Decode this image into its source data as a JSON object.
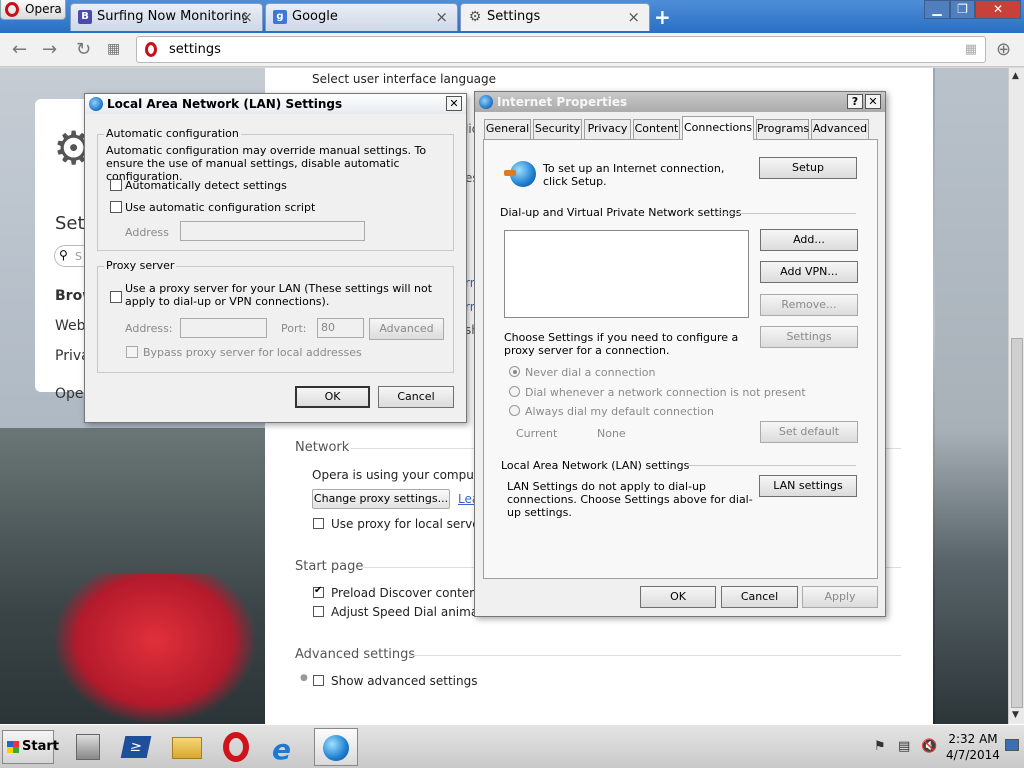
{
  "browser": {
    "menu_label": "Opera",
    "tabs": [
      {
        "label": "Surfing Now Monitoring",
        "icon": "bookmark-b-icon",
        "color": "#4a4ab0"
      },
      {
        "label": "Google",
        "icon": "google-icon",
        "color": "#3c78d8"
      },
      {
        "label": "Settings",
        "icon": "gear-icon",
        "color": "#555555"
      }
    ],
    "address": "settings"
  },
  "settings_page": {
    "left_card": {
      "title": "Set",
      "items": [
        "Brow",
        "Web",
        "Priva",
        "Ope"
      ],
      "search_placeholder": "S"
    },
    "lang_label": "Select user interface language",
    "network": {
      "heading": "Network",
      "description": "Opera is using your computer's sy",
      "change_proxy_button": "Change proxy settings...",
      "learn_link": "Lea",
      "use_proxy_local": "Use proxy for local servers"
    },
    "start_page": {
      "heading": "Start page",
      "preload_discover": "Preload Discover contents wh",
      "adjust_speed_dial": "Adjust Speed Dial animations"
    },
    "advanced": {
      "heading": "Advanced settings",
      "show_advanced": "Show advanced settings"
    },
    "fragments": [
      "lic",
      "es",
      "rr",
      "rr",
      "sh"
    ]
  },
  "lan_dialog": {
    "title": "Local Area Network (LAN) Settings",
    "auto_config": {
      "group_label": "Automatic configuration",
      "description": "Automatic configuration may override manual settings.  To ensure the use of manual settings, disable automatic configuration.",
      "auto_detect": "Automatically detect settings",
      "use_script": "Use automatic configuration script",
      "address_label": "Address"
    },
    "proxy": {
      "group_label": "Proxy server",
      "use_proxy": "Use a proxy server for your LAN (These settings will not apply to dial-up or VPN connections).",
      "address_label": "Address:",
      "port_label": "Port:",
      "port_value": "80",
      "advanced_button": "Advanced",
      "bypass": "Bypass proxy server for local addresses"
    },
    "ok": "OK",
    "cancel": "Cancel"
  },
  "ip_dialog": {
    "title": "Internet Properties",
    "tabs": [
      "General",
      "Security",
      "Privacy",
      "Content",
      "Connections",
      "Programs",
      "Advanced"
    ],
    "active_tab": "Connections",
    "setup_text": "To set up an Internet connection, click Setup.",
    "setup_button": "Setup",
    "dialup_heading": "Dial-up and Virtual Private Network settings",
    "add_button": "Add...",
    "add_vpn_button": "Add VPN...",
    "remove_button": "Remove...",
    "settings_button": "Settings",
    "choose_settings_text": "Choose Settings if you need to configure a proxy server for a connection.",
    "radio_never": "Never dial a connection",
    "radio_whenever": "Dial whenever a network connection is not present",
    "radio_always": "Always dial my default connection",
    "current_label": "Current",
    "current_value": "None",
    "set_default_button": "Set default",
    "lan_heading": "Local Area Network (LAN) settings",
    "lan_text": "LAN Settings do not apply to dial-up connections. Choose Settings above for dial-up settings.",
    "lan_settings_button": "LAN settings",
    "ok": "OK",
    "cancel": "Cancel",
    "apply": "Apply"
  },
  "taskbar": {
    "start_label": "Start",
    "apps": [
      "server-manager-icon",
      "powershell-icon",
      "explorer-folder-icon",
      "opera-icon",
      "internet-explorer-icon",
      "internet-options-icon"
    ],
    "time": "2:32 AM",
    "date": "4/7/2014"
  }
}
